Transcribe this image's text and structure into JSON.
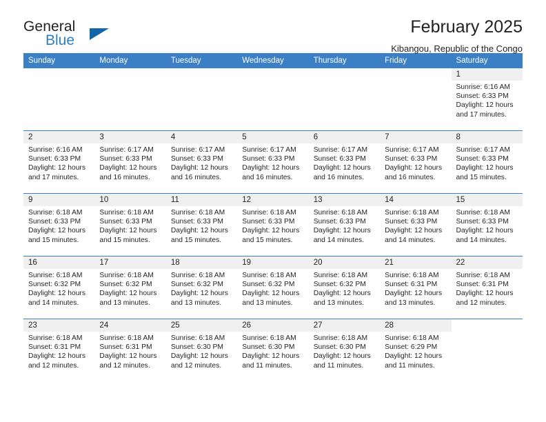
{
  "brand": {
    "name_part1": "General",
    "name_part2": "Blue",
    "triangle_color": "#1266a8",
    "blue_color": "#2a7fc4"
  },
  "header": {
    "title": "February 2025",
    "subtitle": "Kibangou, Republic of the Congo"
  },
  "theme": {
    "header_blue": "#3b7fc4",
    "daynum_bg": "#f0f0f0",
    "text": "#231f20"
  },
  "labels": {
    "sunrise_prefix": "Sunrise:",
    "sunset_prefix": "Sunset:",
    "daylight_prefix": "Daylight:"
  },
  "columns": [
    "Sunday",
    "Monday",
    "Tuesday",
    "Wednesday",
    "Thursday",
    "Friday",
    "Saturday"
  ],
  "weeks": [
    [
      {
        "day": "",
        "blank": true
      },
      {
        "day": "",
        "blank": true
      },
      {
        "day": "",
        "blank": true
      },
      {
        "day": "",
        "blank": true
      },
      {
        "day": "",
        "blank": true
      },
      {
        "day": "",
        "blank": true
      },
      {
        "day": "1",
        "sunrise": "Sunrise: 6:16 AM",
        "sunset": "Sunset: 6:33 PM",
        "daylight1": "Daylight: 12 hours",
        "daylight2": "and 17 minutes."
      }
    ],
    [
      {
        "day": "2",
        "sunrise": "Sunrise: 6:16 AM",
        "sunset": "Sunset: 6:33 PM",
        "daylight1": "Daylight: 12 hours",
        "daylight2": "and 17 minutes."
      },
      {
        "day": "3",
        "sunrise": "Sunrise: 6:17 AM",
        "sunset": "Sunset: 6:33 PM",
        "daylight1": "Daylight: 12 hours",
        "daylight2": "and 16 minutes."
      },
      {
        "day": "4",
        "sunrise": "Sunrise: 6:17 AM",
        "sunset": "Sunset: 6:33 PM",
        "daylight1": "Daylight: 12 hours",
        "daylight2": "and 16 minutes."
      },
      {
        "day": "5",
        "sunrise": "Sunrise: 6:17 AM",
        "sunset": "Sunset: 6:33 PM",
        "daylight1": "Daylight: 12 hours",
        "daylight2": "and 16 minutes."
      },
      {
        "day": "6",
        "sunrise": "Sunrise: 6:17 AM",
        "sunset": "Sunset: 6:33 PM",
        "daylight1": "Daylight: 12 hours",
        "daylight2": "and 16 minutes."
      },
      {
        "day": "7",
        "sunrise": "Sunrise: 6:17 AM",
        "sunset": "Sunset: 6:33 PM",
        "daylight1": "Daylight: 12 hours",
        "daylight2": "and 16 minutes."
      },
      {
        "day": "8",
        "sunrise": "Sunrise: 6:17 AM",
        "sunset": "Sunset: 6:33 PM",
        "daylight1": "Daylight: 12 hours",
        "daylight2": "and 15 minutes."
      }
    ],
    [
      {
        "day": "9",
        "sunrise": "Sunrise: 6:18 AM",
        "sunset": "Sunset: 6:33 PM",
        "daylight1": "Daylight: 12 hours",
        "daylight2": "and 15 minutes."
      },
      {
        "day": "10",
        "sunrise": "Sunrise: 6:18 AM",
        "sunset": "Sunset: 6:33 PM",
        "daylight1": "Daylight: 12 hours",
        "daylight2": "and 15 minutes."
      },
      {
        "day": "11",
        "sunrise": "Sunrise: 6:18 AM",
        "sunset": "Sunset: 6:33 PM",
        "daylight1": "Daylight: 12 hours",
        "daylight2": "and 15 minutes."
      },
      {
        "day": "12",
        "sunrise": "Sunrise: 6:18 AM",
        "sunset": "Sunset: 6:33 PM",
        "daylight1": "Daylight: 12 hours",
        "daylight2": "and 15 minutes."
      },
      {
        "day": "13",
        "sunrise": "Sunrise: 6:18 AM",
        "sunset": "Sunset: 6:33 PM",
        "daylight1": "Daylight: 12 hours",
        "daylight2": "and 14 minutes."
      },
      {
        "day": "14",
        "sunrise": "Sunrise: 6:18 AM",
        "sunset": "Sunset: 6:33 PM",
        "daylight1": "Daylight: 12 hours",
        "daylight2": "and 14 minutes."
      },
      {
        "day": "15",
        "sunrise": "Sunrise: 6:18 AM",
        "sunset": "Sunset: 6:33 PM",
        "daylight1": "Daylight: 12 hours",
        "daylight2": "and 14 minutes."
      }
    ],
    [
      {
        "day": "16",
        "sunrise": "Sunrise: 6:18 AM",
        "sunset": "Sunset: 6:32 PM",
        "daylight1": "Daylight: 12 hours",
        "daylight2": "and 14 minutes."
      },
      {
        "day": "17",
        "sunrise": "Sunrise: 6:18 AM",
        "sunset": "Sunset: 6:32 PM",
        "daylight1": "Daylight: 12 hours",
        "daylight2": "and 13 minutes."
      },
      {
        "day": "18",
        "sunrise": "Sunrise: 6:18 AM",
        "sunset": "Sunset: 6:32 PM",
        "daylight1": "Daylight: 12 hours",
        "daylight2": "and 13 minutes."
      },
      {
        "day": "19",
        "sunrise": "Sunrise: 6:18 AM",
        "sunset": "Sunset: 6:32 PM",
        "daylight1": "Daylight: 12 hours",
        "daylight2": "and 13 minutes."
      },
      {
        "day": "20",
        "sunrise": "Sunrise: 6:18 AM",
        "sunset": "Sunset: 6:32 PM",
        "daylight1": "Daylight: 12 hours",
        "daylight2": "and 13 minutes."
      },
      {
        "day": "21",
        "sunrise": "Sunrise: 6:18 AM",
        "sunset": "Sunset: 6:31 PM",
        "daylight1": "Daylight: 12 hours",
        "daylight2": "and 13 minutes."
      },
      {
        "day": "22",
        "sunrise": "Sunrise: 6:18 AM",
        "sunset": "Sunset: 6:31 PM",
        "daylight1": "Daylight: 12 hours",
        "daylight2": "and 12 minutes."
      }
    ],
    [
      {
        "day": "23",
        "sunrise": "Sunrise: 6:18 AM",
        "sunset": "Sunset: 6:31 PM",
        "daylight1": "Daylight: 12 hours",
        "daylight2": "and 12 minutes."
      },
      {
        "day": "24",
        "sunrise": "Sunrise: 6:18 AM",
        "sunset": "Sunset: 6:31 PM",
        "daylight1": "Daylight: 12 hours",
        "daylight2": "and 12 minutes."
      },
      {
        "day": "25",
        "sunrise": "Sunrise: 6:18 AM",
        "sunset": "Sunset: 6:30 PM",
        "daylight1": "Daylight: 12 hours",
        "daylight2": "and 12 minutes."
      },
      {
        "day": "26",
        "sunrise": "Sunrise: 6:18 AM",
        "sunset": "Sunset: 6:30 PM",
        "daylight1": "Daylight: 12 hours",
        "daylight2": "and 11 minutes."
      },
      {
        "day": "27",
        "sunrise": "Sunrise: 6:18 AM",
        "sunset": "Sunset: 6:30 PM",
        "daylight1": "Daylight: 12 hours",
        "daylight2": "and 11 minutes."
      },
      {
        "day": "28",
        "sunrise": "Sunrise: 6:18 AM",
        "sunset": "Sunset: 6:29 PM",
        "daylight1": "Daylight: 12 hours",
        "daylight2": "and 11 minutes."
      },
      {
        "day": "",
        "blank": true
      }
    ]
  ]
}
